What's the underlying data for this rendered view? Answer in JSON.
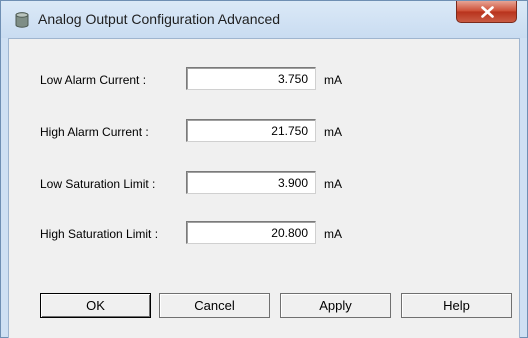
{
  "window": {
    "title": "Analog Output Configuration Advanced",
    "icons": {
      "app": "cylinder-icon",
      "close": "close-x-icon"
    },
    "colors": {
      "close_button": "#c9422a",
      "title_bar": "#cfe0f3"
    }
  },
  "fields": [
    {
      "label": "Low Alarm Current :",
      "value": "3.750",
      "unit": "mA"
    },
    {
      "label": "High Alarm Current :",
      "value": "21.750",
      "unit": "mA"
    },
    {
      "label": "Low Saturation Limit :",
      "value": "3.900",
      "unit": "mA"
    },
    {
      "label": "High Saturation Limit :",
      "value": "20.800",
      "unit": "mA"
    }
  ],
  "buttons": {
    "ok": "OK",
    "cancel": "Cancel",
    "apply": "Apply",
    "help": "Help"
  }
}
